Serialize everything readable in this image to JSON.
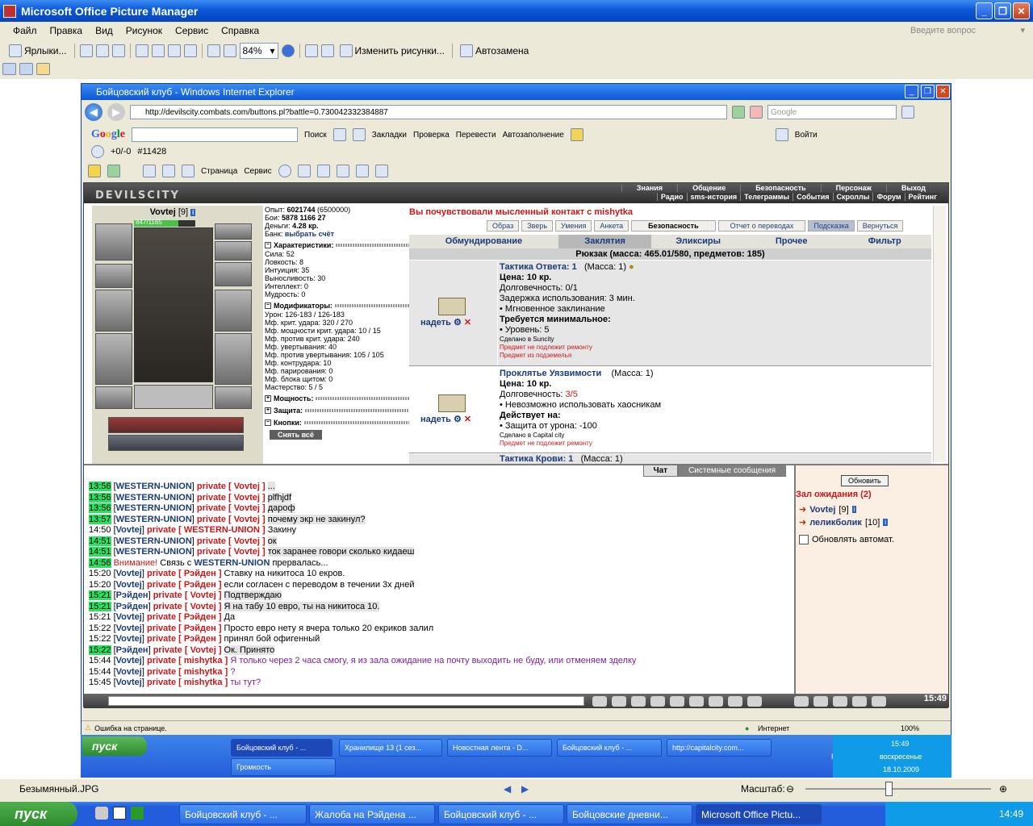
{
  "app": {
    "title": "Microsoft Office Picture Manager"
  },
  "menu": [
    "Файл",
    "Правка",
    "Вид",
    "Рисунок",
    "Сервис",
    "Справка"
  ],
  "ask_placeholder": "Введите вопрос",
  "toolbar": {
    "shortcuts": "Ярлыки...",
    "zoom": "84%",
    "edit": "Изменить рисунки...",
    "autofix": "Автозамена"
  },
  "ie": {
    "title": "Бойцовский клуб - Windows Internet Explorer",
    "url": "http://devilscity.combats.com/buttons.pl?battle=0.730042332384887",
    "search_placeholder": "Google",
    "google": {
      "logo": "Google",
      "search": "Поиск",
      "bookmarks": "Закладки",
      "check": "Проверка",
      "translate": "Перевести",
      "autofill": "Автозаполнение",
      "login": "Войти"
    },
    "google2": {
      "pr": "+0/-0",
      "id": "#11428"
    },
    "cmd": {
      "page": "Страница",
      "service": "Сервис"
    },
    "status": "Ошибка на странице.",
    "zone": "Интернет",
    "zoom": "100%"
  },
  "game": {
    "logo": "DEVILSCITY",
    "nav1": [
      "Знания",
      "Общение",
      "Безопасность",
      "Персонаж",
      "Выход"
    ],
    "nav2": [
      "Радио",
      "sms-история",
      "Телеграммы",
      "События",
      "Скроллы",
      "Форум",
      "Рейтинг"
    ],
    "player": {
      "name": "Vovtej",
      "level": "[9]",
      "hp": "847/1165"
    },
    "stats": {
      "exp_label": "Опыт:",
      "exp": "6021744",
      "exp_next": "(6500000)",
      "fights_label": "Бои:",
      "wins": "5878",
      "losses": "1166",
      "draws": "27",
      "money_label": "Деньги:",
      "money": "4.28 кр.",
      "bank_label": "Банк:",
      "bank": "выбрать счёт",
      "sec_chars": "Характеристики:",
      "chars": [
        "Сила: 52",
        "Ловкость: 8",
        "Интуиция: 35",
        "Выносливость: 30",
        "Интеллект: 0",
        "Мудрость: 0"
      ],
      "sec_mods": "Модификаторы:",
      "mods": [
        "Урон: 126-183 / 126-183",
        "Мф. крит. удара: 320 / 270",
        "Мф. мощности крит. удара: 10 / 15",
        "Мф. против крит. удара: 240",
        "Мф. увертывания: 40",
        "Мф. против увертывания: 105 / 105",
        "Мф. контрудара: 10",
        "Мф. парирования: 0",
        "Мф. блока щитом: 0",
        "Мастерство: 5 / 5"
      ],
      "sec_power": "Мощность:",
      "sec_protect": "Защита:",
      "sec_buttons": "Кнопки:",
      "remove_all": "Снять всё"
    },
    "notice": "Вы почувствовали мысленный контакт с mishytka",
    "subtabs": [
      "Образ",
      "Зверь",
      "Умения",
      "Анкета",
      "Безопасность",
      "Отчет о переводах",
      "Подсказка",
      "Вернуться"
    ],
    "itemtabs": [
      "Обмундирование",
      "Заклятия",
      "Эликсиры",
      "Прочее",
      "Фильтр"
    ],
    "bag": "Рюкзак (масса: 465.01/580, предметов: 185)",
    "items": [
      {
        "wear": "надеть",
        "name": "Тактика Ответа: 1",
        "mass": "(Масса: 1)",
        "price": "Цена: 10 кр.",
        "dur": "Долговечность: 0/1",
        "l1": "Задержка использования: 3 мин.",
        "l2": "• Мгновенное заклинание",
        "req": "Требуется минимальное:",
        "l3": "• Уровень: 5",
        "made": "Сделано в Suncity",
        "r1": "Предмет не подлежит ремонту",
        "r2": "Предмет из подземелья"
      },
      {
        "wear": "надеть",
        "name": "Проклятье Уязвимости",
        "mass": "(Масса: 1)",
        "price": "Цена: 10 кр.",
        "dur_label": "Долговечность: ",
        "dur": "3/5",
        "l1": "• Невозможно использовать хаосникам",
        "req": "Действует на:",
        "l3": "• Защита от урона: -100",
        "made": "Сделано в Capital city",
        "r1": "Предмет не подлежит ремонту"
      },
      {
        "name": "Тактика Крови: 1",
        "mass": "(Масса: 1)"
      }
    ],
    "chat_tabs": [
      "Чат",
      "Системные сообщения"
    ],
    "chat": [
      {
        "t": "13:56",
        "hl": true,
        "from": "WESTERN-UNION",
        "to": "Vovtej",
        "msg": "..."
      },
      {
        "t": "13:56",
        "hl": true,
        "from": "WESTERN-UNION",
        "to": "Vovtej",
        "msg": "plfhjdf"
      },
      {
        "t": "13:56",
        "hl": true,
        "from": "WESTERN-UNION",
        "to": "Vovtej",
        "msg": "дароф"
      },
      {
        "t": "13:57",
        "hl": true,
        "from": "WESTERN-UNION",
        "to": "Vovtej",
        "msg": "почему экр не закинул?"
      },
      {
        "t": "14:50",
        "hl": false,
        "from": "Vovtej",
        "to": "WESTERN-UNION",
        "msg": "Закину"
      },
      {
        "t": "14:51",
        "hl": true,
        "from": "WESTERN-UNION",
        "to": "Vovtej",
        "msg": "ок"
      },
      {
        "t": "14:51",
        "hl": true,
        "from": "WESTERN-UNION",
        "to": "Vovtej",
        "msg": "ток заранее говори сколько кидаеш"
      },
      {
        "t": "14:56",
        "hl": true,
        "sys": "Внимание!",
        "sysmsg1": "Связь с ",
        "sysnick": "WESTERN-UNION",
        "sysmsg2": " прервалась..."
      },
      {
        "t": "15:20",
        "hl": false,
        "from": "Vovtej",
        "to": "Рэйден",
        "msg": "Ставку на никитоса 10 екров."
      },
      {
        "t": "15:20",
        "hl": false,
        "from": "Vovtej",
        "to": "Рэйден",
        "msg": "если согласен с переводом в течении 3х дней"
      },
      {
        "t": "15:21",
        "hl": true,
        "from": "Рэйден",
        "to": "Vovtej",
        "msg": "Подтверждаю"
      },
      {
        "t": "15:21",
        "hl": true,
        "from": "Рэйден",
        "to": "Vovtej",
        "msg": "Я на табу 10 евро, ты на никитоса 10."
      },
      {
        "t": "15:21",
        "hl": false,
        "from": "Vovtej",
        "to": "Рэйден",
        "msg": "Да"
      },
      {
        "t": "15:22",
        "hl": false,
        "from": "Vovtej",
        "to": "Рэйден",
        "msg": "Просто евро нету я вчера только 20 екриков залил"
      },
      {
        "t": "15:22",
        "hl": false,
        "from": "Vovtej",
        "to": "Рэйден",
        "msg": "принял бой офигенный"
      },
      {
        "t": "15:22",
        "hl": true,
        "from": "Рэйден",
        "to": "Vovtej",
        "msg": "Ок. Принято"
      },
      {
        "t": "15:44",
        "hl": false,
        "from": "Vovtej",
        "to": "mishytka",
        "msg": "Я только через 2 часа смогу, я из зала ожидание на почту выходить не буду, или отменяем зделку"
      },
      {
        "t": "15:44",
        "hl": false,
        "from": "Vovtej",
        "to": "mishytka",
        "msg": "?"
      },
      {
        "t": "15:45",
        "hl": false,
        "from": "Vovtej",
        "to": "mishytka",
        "msg": "ты тут?"
      }
    ],
    "private": "private",
    "wait": {
      "refresh": "Обновить",
      "title": "Зал ожидания (2)",
      "players": [
        {
          "name": "Vovtej",
          "level": "[9]"
        },
        {
          "name": "леликболик",
          "level": "[10]"
        }
      ],
      "auto": "Обновлять автомат."
    },
    "clock": "15:49"
  },
  "inner_taskbar": {
    "start": "пуск",
    "buttons": [
      "Бойцовский клуб - ...",
      "Хранилище 13 (1 сез...",
      "Новостная лента - D...",
      "Бойцовский клуб - ...",
      "http://capitalcity.com..."
    ],
    "volume": "Громкость",
    "lang": "RU",
    "time": "15:49",
    "day": "воскресенье",
    "date": "18.10.2009"
  },
  "pm_status": {
    "file": "Безымянный.JPG",
    "scale": "Масштаб:"
  },
  "taskbar": {
    "start": "пуск",
    "buttons": [
      "Бойцовский клуб - ...",
      "Жалоба на Рэйдена ...",
      "Бойцовский клуб - ...",
      "Бойцовские дневни...",
      "Microsoft Office Pictu..."
    ],
    "lang": "RU",
    "time": "14:49"
  }
}
